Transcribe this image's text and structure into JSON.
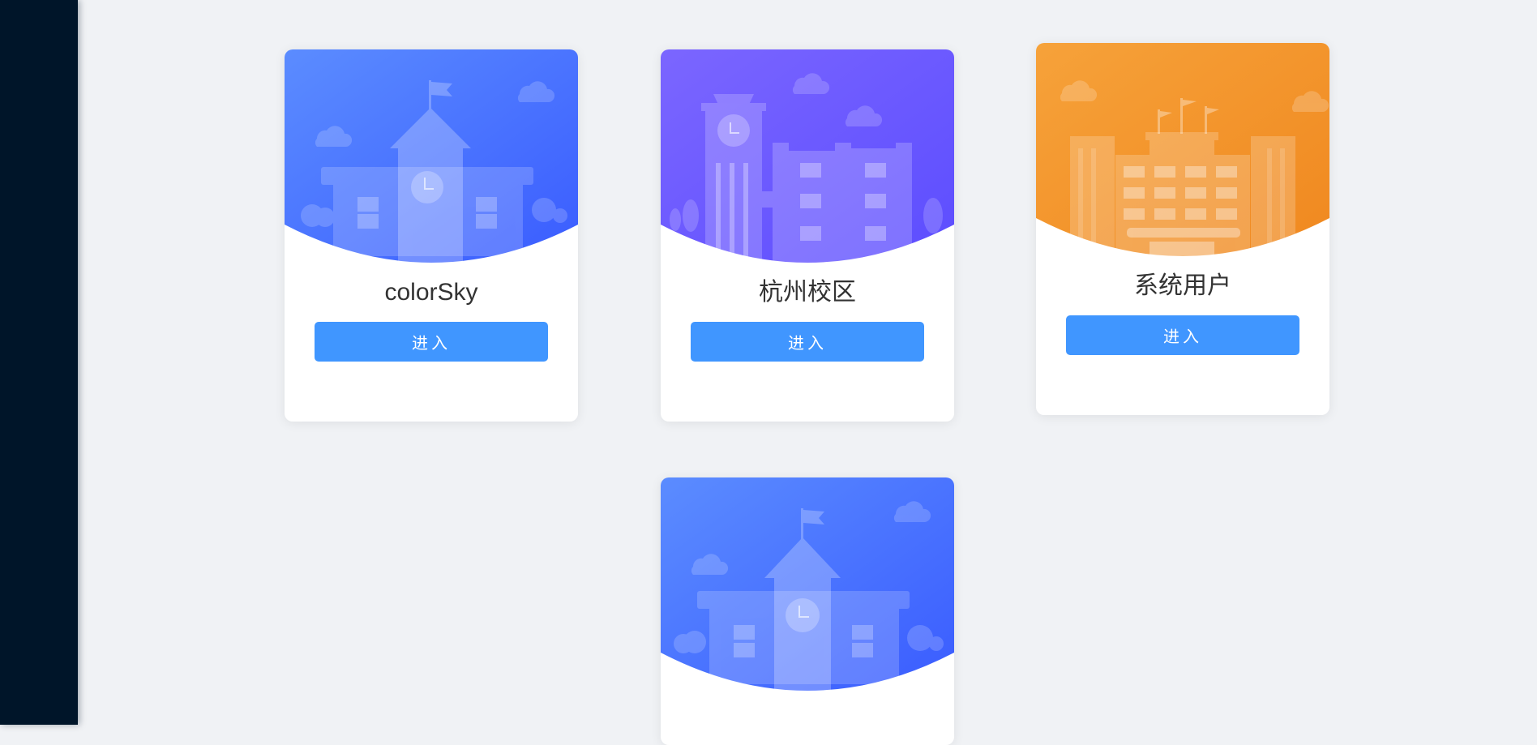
{
  "sidebar": {},
  "cards": [
    {
      "name": "colorSky",
      "button_label": "进入",
      "theme": "blue",
      "illustration": "school-clock-tower-icon"
    },
    {
      "name": "杭州校区",
      "button_label": "进入",
      "theme": "purple",
      "illustration": "campus-buildings-icon"
    },
    {
      "name": "系统用户",
      "button_label": "进入",
      "theme": "orange",
      "illustration": "office-building-icon"
    },
    {
      "name": "",
      "button_label": "",
      "theme": "blue",
      "illustration": "school-clock-tower-icon"
    }
  ],
  "colors": {
    "sidebar": "#001529",
    "background": "#f0f2f5",
    "button": "#4096ff",
    "blue_top": "#5b8cff",
    "blue_bottom": "#3a5cff",
    "purple_top": "#7b66ff",
    "purple_bottom": "#5c4dff",
    "orange_top": "#f6a23a",
    "orange_bottom": "#f0881f"
  }
}
